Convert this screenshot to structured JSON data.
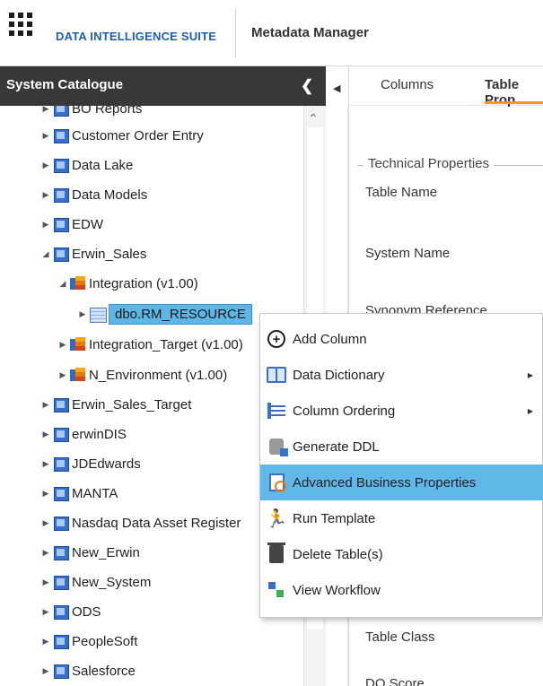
{
  "header": {
    "brand": "DATA INTELLIGENCE SUITE",
    "app_name": "Metadata Manager"
  },
  "sidebar": {
    "title": "System Catalogue",
    "collapse_icon": "chevron-left-icon",
    "tree": [
      {
        "label": "BO Reports",
        "type": "server",
        "expanded": false
      },
      {
        "label": "Customer Order Entry",
        "type": "server",
        "expanded": false
      },
      {
        "label": "Data Lake",
        "type": "server",
        "expanded": false
      },
      {
        "label": "Data Models",
        "type": "server",
        "expanded": false
      },
      {
        "label": "EDW",
        "type": "server",
        "expanded": false
      },
      {
        "label": "Erwin_Sales",
        "type": "server",
        "expanded": true
      },
      {
        "label": "Integration (v1.00)",
        "type": "model",
        "expanded": true
      },
      {
        "label": "dbo.RM_RESOURCE",
        "type": "table",
        "expanded": false,
        "selected": true
      },
      {
        "label": "Integration_Target (v1.00)",
        "type": "model",
        "expanded": false
      },
      {
        "label": "N_Environment (v1.00)",
        "type": "model",
        "expanded": false
      },
      {
        "label": "Erwin_Sales_Target",
        "type": "server",
        "expanded": false
      },
      {
        "label": "erwinDIS",
        "type": "server",
        "expanded": false
      },
      {
        "label": "JDEdwards",
        "type": "server",
        "expanded": false
      },
      {
        "label": "MANTA",
        "type": "server",
        "expanded": false
      },
      {
        "label": "Nasdaq Data Asset Register",
        "type": "server",
        "expanded": false
      },
      {
        "label": "New_Erwin",
        "type": "server",
        "expanded": false
      },
      {
        "label": "New_System",
        "type": "server",
        "expanded": false
      },
      {
        "label": "ODS",
        "type": "server",
        "expanded": false
      },
      {
        "label": "PeopleSoft",
        "type": "server",
        "expanded": false
      },
      {
        "label": "Salesforce",
        "type": "server",
        "expanded": false
      }
    ]
  },
  "tabs": [
    {
      "label": "Columns",
      "active": false
    },
    {
      "label": "Table Prop",
      "active": true
    }
  ],
  "properties": {
    "section": "Technical Properties",
    "fields": [
      "Table Name",
      "System Name",
      "Synonym Reference",
      "Table Class",
      "DQ Score"
    ]
  },
  "context_menu": {
    "items": [
      {
        "label": "Add Column",
        "icon": "add-circle-icon",
        "submenu": false
      },
      {
        "label": "Data Dictionary",
        "icon": "book-icon",
        "submenu": true
      },
      {
        "label": "Column Ordering",
        "icon": "list-icon",
        "submenu": true
      },
      {
        "label": "Generate DDL",
        "icon": "ddl-icon",
        "submenu": false
      },
      {
        "label": "Advanced Business Properties",
        "icon": "document-search-icon",
        "submenu": false,
        "highlighted": true
      },
      {
        "label": "Run Template",
        "icon": "run-icon",
        "submenu": false
      },
      {
        "label": "Delete Table(s)",
        "icon": "trash-icon",
        "submenu": false
      },
      {
        "label": "View Workflow",
        "icon": "workflow-icon",
        "submenu": false
      }
    ]
  },
  "colors": {
    "header_bg": "#38383b",
    "selection": "#5fb6e6",
    "accent": "#f59a1b",
    "brand": "#1d5fae"
  }
}
